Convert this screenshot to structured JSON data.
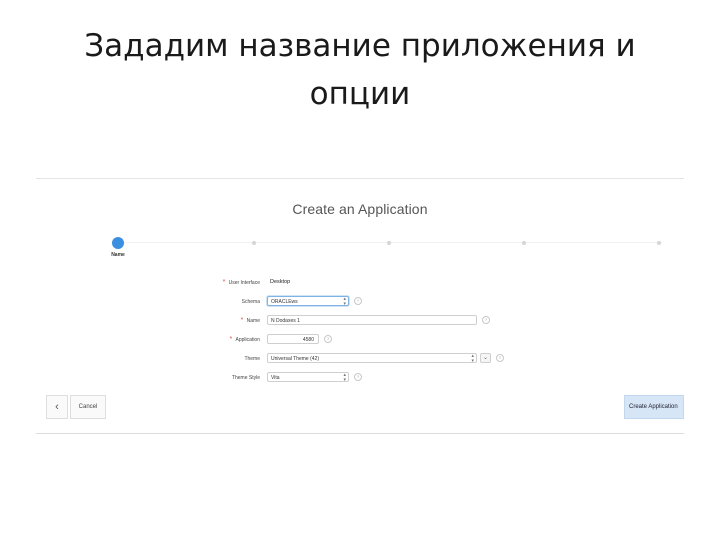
{
  "slide": {
    "title_line1": "Зададим название приложения и",
    "title_line2": "опции"
  },
  "dialog": {
    "title": "Create an Application",
    "wizard": {
      "active_step_label": "Name",
      "step_count": 5
    },
    "form": {
      "user_interface": {
        "label": "User Interface",
        "value": "Desktop",
        "required": true
      },
      "schema": {
        "label": "Schema",
        "value": "ORACLEws",
        "icon": "chevron-down-icon"
      },
      "name": {
        "label": "Name",
        "value": "N Dodaxes 1",
        "required": true
      },
      "application": {
        "label": "Application",
        "value": "4580",
        "required": true
      },
      "theme": {
        "label": "Theme",
        "value": "Universal Theme (42)",
        "icon": "chevron-down-icon"
      },
      "theme_style": {
        "label": "Theme Style",
        "value": "Vita"
      }
    },
    "footer": {
      "back_icon": "‹",
      "cancel_label": "Cancel",
      "create_label": "Create Application"
    }
  },
  "colors": {
    "accent": "#3a8fe0",
    "primary_button": "#d6e6f6",
    "required": "#d9534f"
  }
}
